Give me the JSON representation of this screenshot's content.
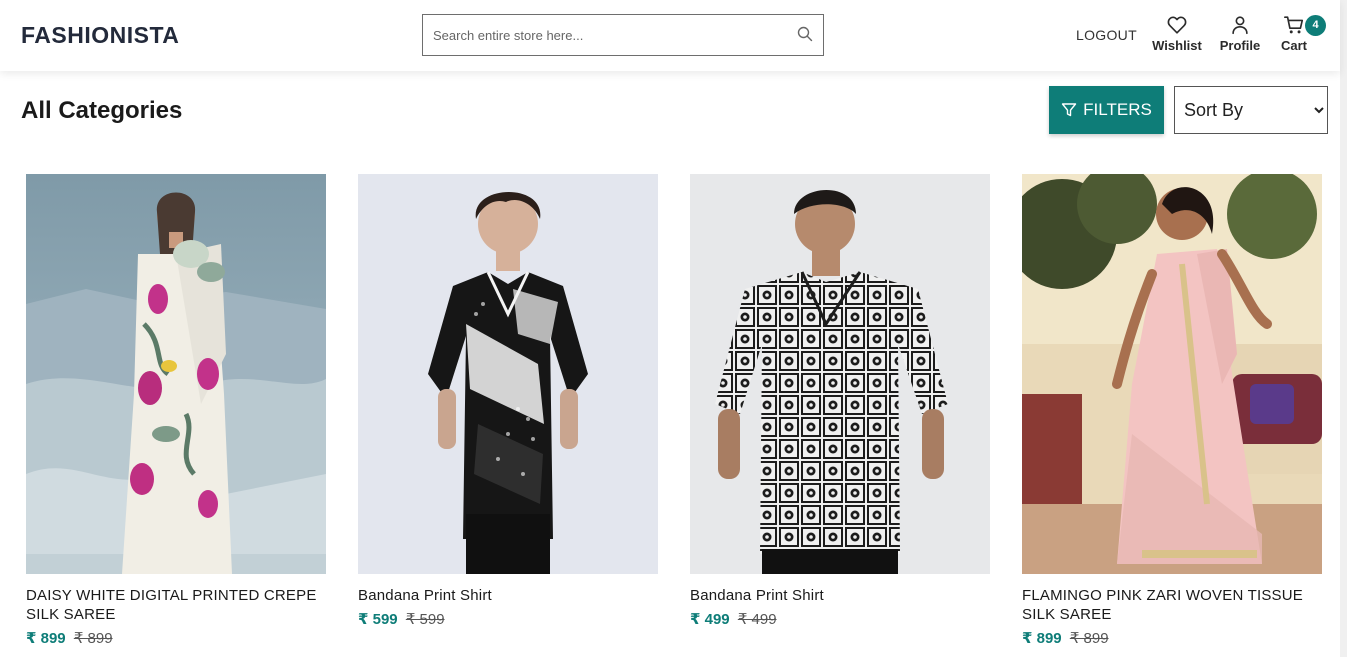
{
  "brand": {
    "name": "FASHIONISTA"
  },
  "search": {
    "placeholder": "Search entire store here..."
  },
  "nav": {
    "logout": "LOGOUT",
    "wishlist": "Wishlist",
    "profile": "Profile",
    "cart": "Cart",
    "cart_count": "4"
  },
  "page": {
    "title": "All Categories"
  },
  "toolbar": {
    "filters_label": "FILTERS",
    "sort_selected": "Sort By"
  },
  "products": [
    {
      "name": "DAISY WHITE DIGITAL PRINTED CREPE SILK SAREE",
      "price": "₹ 899",
      "original_price": "₹ 899"
    },
    {
      "name": "Bandana Print Shirt",
      "price": "₹ 599",
      "original_price": "₹ 599"
    },
    {
      "name": "Bandana Print Shirt",
      "price": "₹ 499",
      "original_price": "₹ 499"
    },
    {
      "name": "FLAMINGO PINK ZARI WOVEN TISSUE SILK SAREE",
      "price": "₹ 899",
      "original_price": "₹ 899"
    }
  ],
  "colors": {
    "accent": "#0e7d78",
    "logo": "#232a3b",
    "text": "#1a1a1a"
  },
  "icons": {
    "search": "search-icon",
    "wishlist": "heart-icon",
    "profile": "user-icon",
    "cart": "cart-icon",
    "filters": "funnel-icon"
  }
}
